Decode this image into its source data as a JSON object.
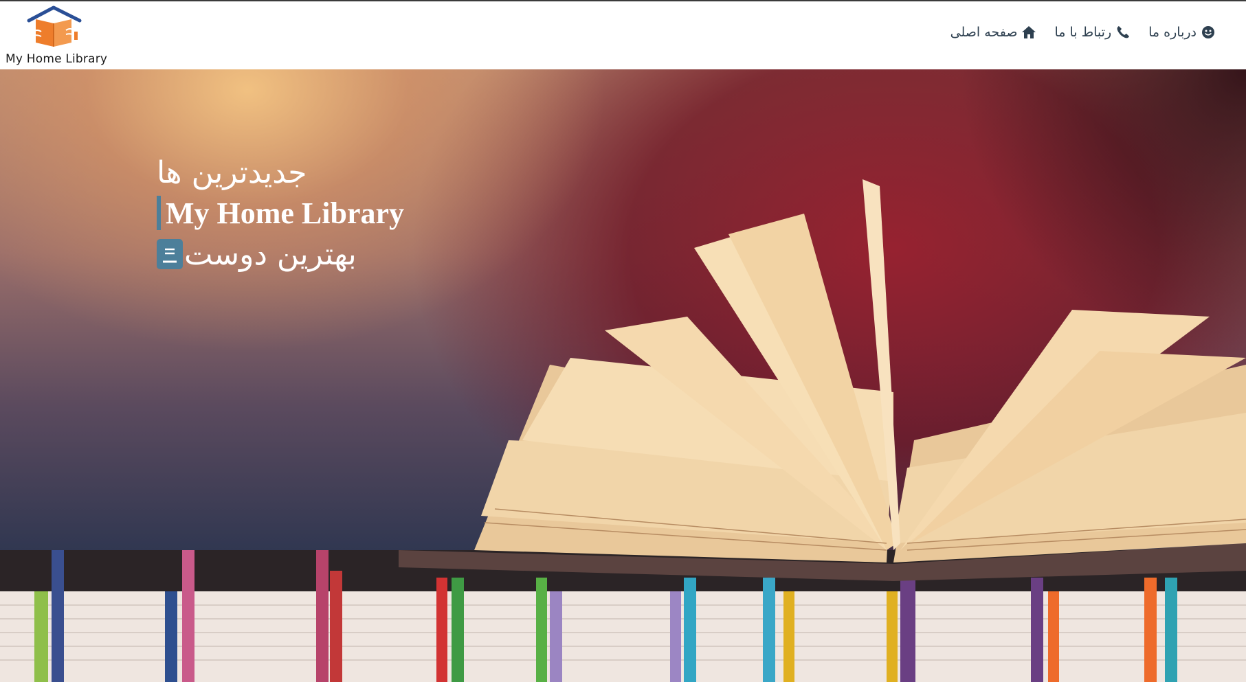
{
  "brand": {
    "logo_text": "My Home Library",
    "logo_icon": "house-book-icon",
    "colors": {
      "roof": "#2a4f96",
      "book": "#ee7d2b",
      "hands": "#ffffff"
    }
  },
  "nav": {
    "items": [
      {
        "label": "صفحه اصلی",
        "icon": "home-icon"
      },
      {
        "label": "رتباط با ما",
        "icon": "phone-icon"
      },
      {
        "label": "درباره ما",
        "icon": "smile-icon"
      }
    ],
    "text_color": "#2e4050"
  },
  "hero": {
    "line1": "جدیدترین ها",
    "line2": "My Home Library",
    "line3": "بهترین دوست",
    "accent_color": "#4c7f9a",
    "line3_icon": "book-icon",
    "background": "open-book-on-shelf-photo"
  }
}
